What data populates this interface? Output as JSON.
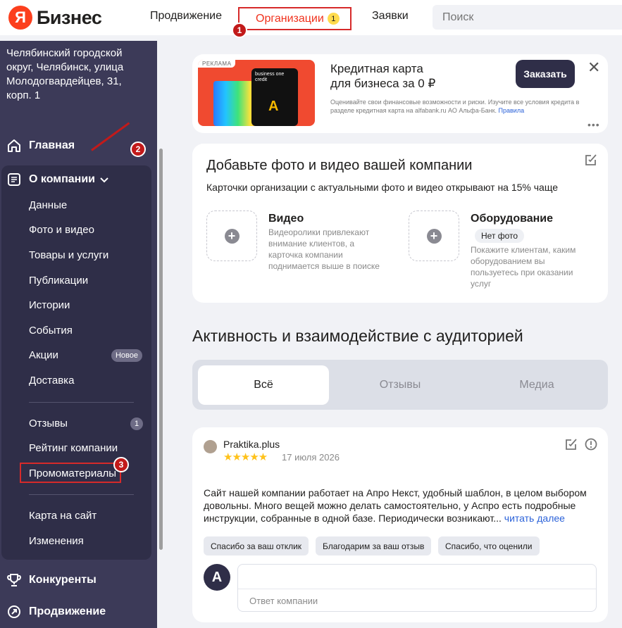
{
  "topbar": {
    "logo_letter": "Я",
    "logo_text": "Бизнес",
    "nav": [
      "Продвижение",
      "Организации",
      "Заявки"
    ],
    "org_badge": "1",
    "search_placeholder": "Поиск"
  },
  "callouts": [
    "1",
    "2",
    "3"
  ],
  "sidebar": {
    "address": "Челябинский городской округ, Челябинск, улица Молодогвардейцев, 31, корп. 1",
    "home": "Главная",
    "about": "О компании",
    "sub_items": [
      "Данные",
      "Фото и видео",
      "Товары и услуги",
      "Публикации",
      "Истории",
      "События",
      "Акции",
      "Доставка"
    ],
    "new_badge": "Новое",
    "group2": [
      "Отзывы",
      "Рейтинг компании",
      "Промоматериалы"
    ],
    "reviews_count": "1",
    "group3": [
      "Карта на сайт",
      "Изменения"
    ],
    "competitors": "Конкуренты",
    "promotion": "Продвижение"
  },
  "ad": {
    "label": "РЕКЛАМА",
    "phone_text": "business one credit",
    "title_line1": "Кредитная карта",
    "title_line2": "для бизнеса за 0 ₽",
    "legal": "Оценивайте свои финансовые возможности и риски. Изучите все условия кредита в разделе кредитная карта на alfabank.ru АО Альфа-Банк.",
    "legal_link": "Правила",
    "button": "Заказать",
    "close": "✕",
    "more": "•••"
  },
  "photo_card": {
    "title": "Добавьте фото и видео вашей компании",
    "subtitle": "Карточки организации с актуальными фото и видео открывают на 15% чаще",
    "video_title": "Видео",
    "video_desc": "Видеоролики привлекают внимание клиентов, а карточка компании поднимается выше в поиске",
    "equip_title": "Оборудование",
    "equip_badge": "Нет фото",
    "equip_desc": "Покажите клиентам, каким оборудованием вы пользуетесь при оказании услуг"
  },
  "activity": {
    "title": "Активность и взаимодействие с аудиторией",
    "tabs": [
      "Всё",
      "Отзывы",
      "Медиа"
    ]
  },
  "review": {
    "author": "Praktika.plus",
    "rating": 5,
    "stars": "★★★★★",
    "date": "17 июля 2026",
    "text": "Сайт нашей компании работает на Апро Некст, удобный шаблон, в целом выбором довольны. Много вещей можно делать самостоятельно, у Аспро есть подробные инструкции, собранные в одной базе. Периодически возникают...",
    "read_more": "читать далее",
    "chips": [
      "Спасибо за ваш отклик",
      "Благодарим за ваш отзыв",
      "Спасибо, что оценили"
    ],
    "avatar_letter": "А",
    "reply_placeholder": "Ответ компании"
  },
  "colors": {
    "sidebar_bg": "#3c3a58",
    "accent_red": "#f0321d",
    "annotation_red": "#d62a2a",
    "link_blue": "#2b62d9",
    "star": "#ffc21a"
  }
}
